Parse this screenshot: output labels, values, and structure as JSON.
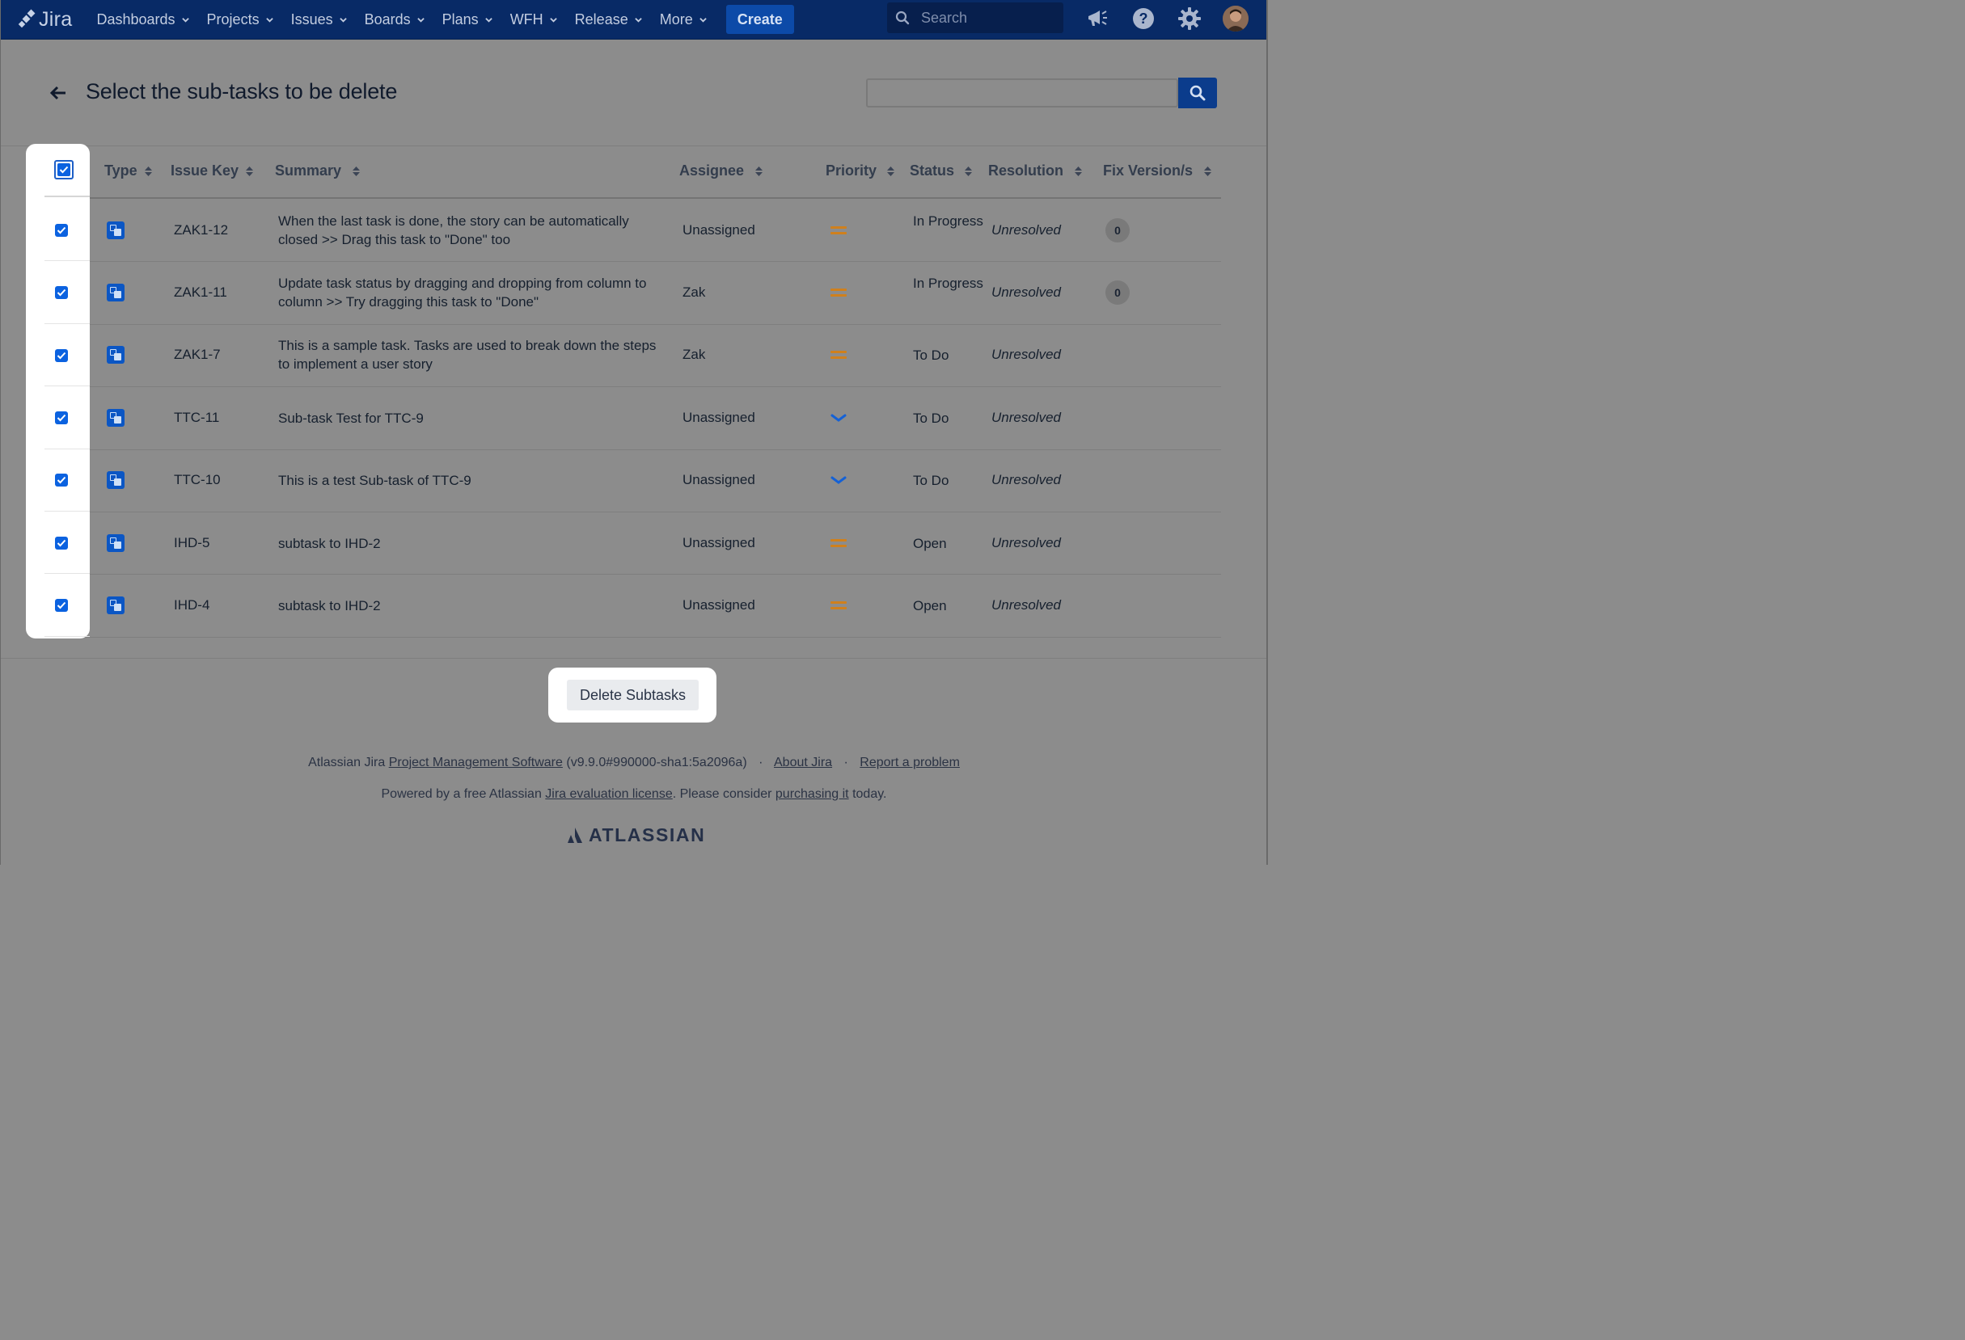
{
  "app": {
    "name": "Jira"
  },
  "nav": {
    "items": [
      "Dashboards",
      "Projects",
      "Issues",
      "Boards",
      "Plans",
      "WFH",
      "Release",
      "More"
    ],
    "create_label": "Create",
    "search_placeholder": "Search"
  },
  "page": {
    "title": "Select the sub-tasks to be delete"
  },
  "table": {
    "headers": {
      "type": "Type",
      "issue_key": "Issue Key",
      "summary": "Summary",
      "assignee": "Assignee",
      "priority": "Priority",
      "status": "Status",
      "resolution": "Resolution",
      "fix_versions": "Fix Version/s"
    },
    "rows": [
      {
        "checked": true,
        "key": "ZAK1-12",
        "summary": "When the last task is done, the story can be automatically closed >> Drag this task to \"Done\" too",
        "assignee": "Unassigned",
        "priority": "medium",
        "status": "In Progress",
        "resolution": "Unresolved",
        "fix_versions": "0"
      },
      {
        "checked": true,
        "key": "ZAK1-11",
        "summary": "Update task status by dragging and dropping from column to column >> Try dragging this task to \"Done\"",
        "assignee": "Zak",
        "priority": "medium",
        "status": "In Progress",
        "resolution": "Unresolved",
        "fix_versions": "0"
      },
      {
        "checked": true,
        "key": "ZAK1-7",
        "summary": "This is a sample task. Tasks are used to break down the steps to implement a user story",
        "assignee": "Zak",
        "priority": "medium",
        "status": "To Do",
        "resolution": "Unresolved",
        "fix_versions": ""
      },
      {
        "checked": true,
        "key": "TTC-11",
        "summary": "Sub-task Test for TTC-9",
        "assignee": "Unassigned",
        "priority": "low",
        "status": "To Do",
        "resolution": "Unresolved",
        "fix_versions": ""
      },
      {
        "checked": true,
        "key": "TTC-10",
        "summary": "This is a test Sub-task of TTC-9",
        "assignee": "Unassigned",
        "priority": "low",
        "status": "To Do",
        "resolution": "Unresolved",
        "fix_versions": ""
      },
      {
        "checked": true,
        "key": "IHD-5",
        "summary": "subtask to IHD-2",
        "assignee": "Unassigned",
        "priority": "medium",
        "status": "Open",
        "resolution": "Unresolved",
        "fix_versions": ""
      },
      {
        "checked": true,
        "key": "IHD-4",
        "summary": "subtask to IHD-2",
        "assignee": "Unassigned",
        "priority": "medium",
        "status": "Open",
        "resolution": "Unresolved",
        "fix_versions": ""
      }
    ]
  },
  "actions": {
    "delete_label": "Delete Subtasks"
  },
  "footer": {
    "line1_prefix": "Atlassian Jira",
    "line1_link": "Project Management Software",
    "line1_version": "(v9.9.0#990000-sha1:5a2096a)",
    "about": "About Jira",
    "report": "Report a problem",
    "line2_prefix": "Powered by a free Atlassian",
    "line2_link": "Jira evaluation license",
    "line2_mid": ". Please consider",
    "line2_link2": "purchasing it",
    "line2_suffix": "today.",
    "brand": "ATLASSIAN"
  },
  "colors": {
    "nav_bg": "#082a66",
    "accent": "#0b62e0",
    "priority_medium": "#d0801c",
    "priority_low": "#1461d6",
    "overlay": "#8c8c8c"
  },
  "icons": {
    "back": "arrow-left-icon",
    "search": "search-icon",
    "notifications": "megaphone-icon",
    "help": "help-icon",
    "settings": "gear-icon",
    "subtask_type": "subtask-icon",
    "sort": "sort-icon"
  }
}
